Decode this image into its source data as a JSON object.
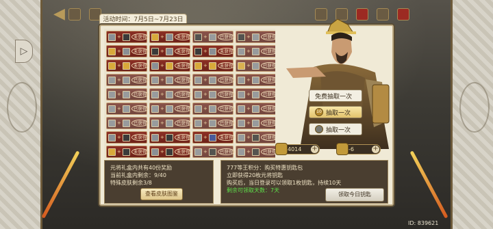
{
  "event": {
    "time_label": "活动时间：7月5日~7月23日"
  },
  "grid": {
    "rows": [
      [
        {
          "i": [
            "grey",
            "dark"
          ],
          "s": "未获得"
        },
        {
          "i": [
            "gold",
            "grey"
          ],
          "s": "未获得"
        },
        {
          "i": [
            "dark",
            "grey"
          ],
          "s": "已获得"
        },
        {
          "i": [
            "dark",
            "grey"
          ],
          "s": "已获得"
        }
      ],
      [
        {
          "i": [
            "gold",
            "grey"
          ],
          "s": "未获得"
        },
        {
          "i": [
            "dark",
            "grey"
          ],
          "s": "未获得"
        },
        {
          "i": [
            "dark",
            "grey"
          ],
          "s": "未获得"
        },
        {
          "i": [
            "grey",
            "grey"
          ],
          "s": "已获得"
        }
      ],
      [
        {
          "i": [
            "gold",
            "gold"
          ],
          "s": "未获得"
        },
        {
          "i": [
            "grey",
            "gold"
          ],
          "s": "未获得"
        },
        {
          "i": [
            "gold",
            "gold"
          ],
          "s": "未获得"
        },
        {
          "i": [
            "gold",
            "grey"
          ],
          "s": "已获得"
        }
      ],
      [
        {
          "i": [
            "grey",
            "grey"
          ],
          "s": "已获得"
        },
        {
          "i": [
            "grey",
            "grey"
          ],
          "s": "已获得"
        },
        {
          "i": [
            "grey",
            "grey"
          ],
          "s": "已获得"
        },
        {
          "i": [
            "grey",
            "grey"
          ],
          "s": "已获得"
        }
      ],
      [
        {
          "i": [
            "grey",
            "grey"
          ],
          "s": "已获得"
        },
        {
          "i": [
            "grey",
            "grey"
          ],
          "s": "已获得"
        },
        {
          "i": [
            "grey",
            "grey"
          ],
          "s": "已获得"
        },
        {
          "i": [
            "grey",
            "grey"
          ],
          "s": "已获得"
        }
      ],
      [
        {
          "i": [
            "grey",
            "grey"
          ],
          "s": "已获得"
        },
        {
          "i": [
            "grey",
            "grey"
          ],
          "s": "已获得"
        },
        {
          "i": [
            "grey",
            "grey"
          ],
          "s": "已获得"
        },
        {
          "i": [
            "grey",
            "grey"
          ],
          "s": "已获得"
        }
      ],
      [
        {
          "i": [
            "grey",
            "grey"
          ],
          "s": "已获得"
        },
        {
          "i": [
            "grey",
            "grey"
          ],
          "s": "已获得"
        },
        {
          "i": [
            "grey",
            "grey"
          ],
          "s": "已获得"
        },
        {
          "i": [
            "grey",
            "grey"
          ],
          "s": "已获得"
        }
      ],
      [
        {
          "i": [
            "grey",
            "dark"
          ],
          "s": "未获得"
        },
        {
          "i": [
            "grey",
            "dark"
          ],
          "s": "未获得"
        },
        {
          "i": [
            "grey",
            "blue"
          ],
          "s": "未获得"
        },
        {
          "i": [
            "grey",
            "dark"
          ],
          "s": "已获得"
        }
      ],
      [
        {
          "i": [
            "gold",
            "dark"
          ],
          "s": "未获得"
        },
        {
          "i": [
            "grey",
            "dark"
          ],
          "s": "未获得"
        },
        {
          "i": [
            "grey",
            "dark"
          ],
          "s": "已获得"
        },
        {
          "i": [
            "grey",
            "dark"
          ],
          "s": "已获得"
        }
      ],
      [
        {
          "i": [
            "grey",
            "purple"
          ],
          "s": "未获得"
        },
        {
          "i": [
            "grey",
            "dark"
          ],
          "s": "未获得"
        },
        {
          "i": [
            "grey",
            "dark"
          ],
          "s": "已获得"
        },
        {
          "i": [
            "grey",
            "dark"
          ],
          "s": "已获得"
        }
      ]
    ]
  },
  "pulls": {
    "free": "免费抽取一次",
    "ten_cost": "10",
    "ten": "抽取一次",
    "one": "抽取一次"
  },
  "currency": {
    "a_value": "4014",
    "b_value": "-6"
  },
  "info_left": {
    "line1": "元将礼盒内共有40份奖励",
    "line2": "当前礼盒内剩余：9/40",
    "line3": "特殊皮肤剩余3/8",
    "gallery_button": "查看皮肤图鉴"
  },
  "info_right": {
    "line1": "777等王积分：购买特惠钥匙包",
    "line2": "立即获得20枚元将钥匙",
    "line3": "购买后，当日登录可以领取1枚钥匙，持续10天",
    "line4": "剩余可领取天数：7天",
    "claim_button": "领取今日钥匙"
  },
  "footer": {
    "id": "ID: 839621"
  },
  "colors": {
    "cell_red": "#8c2f25",
    "panel_bg": "#f0ead6",
    "green_text": "#5fe04a"
  }
}
